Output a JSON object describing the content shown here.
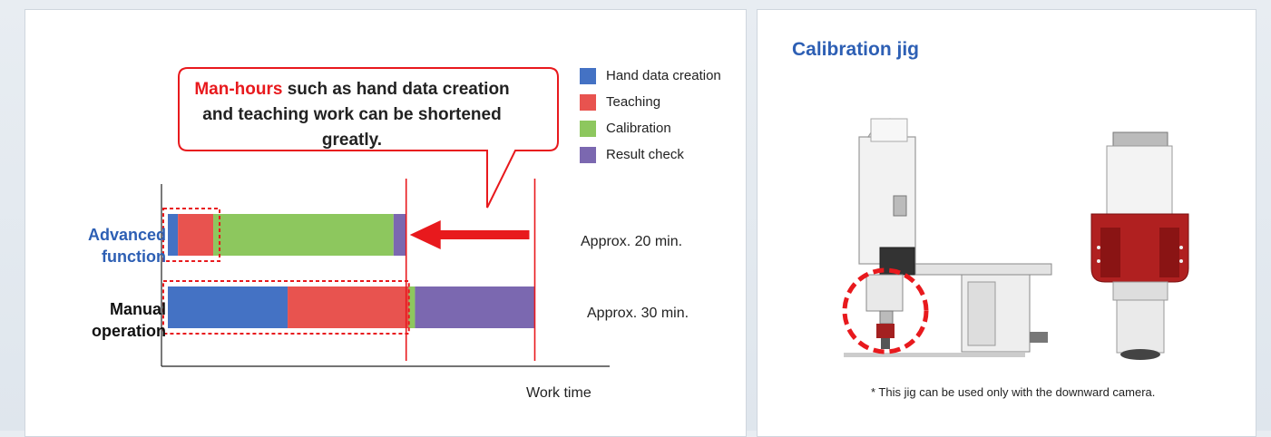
{
  "left_panel": {
    "callout": {
      "highlight": "Man-hours",
      "rest": " such as hand data creation and teaching work can be shortened greatly."
    }
  },
  "right_panel": {
    "title": "Calibration jig",
    "footnote": "* This jig can be used only with the downward camera."
  },
  "chart_data": {
    "type": "bar",
    "orientation": "horizontal",
    "stacked": true,
    "categories": [
      "Advanced function",
      "Manual operation"
    ],
    "series": [
      {
        "name": "Hand data creation",
        "color": "#4472c4",
        "values": [
          0.8,
          9.5
        ]
      },
      {
        "name": "Teaching",
        "color": "#e8534f",
        "values": [
          2.8,
          9.6
        ]
      },
      {
        "name": "Calibration",
        "color": "#8dc75e",
        "values": [
          14.3,
          0.5
        ]
      },
      {
        "name": "Result check",
        "color": "#7b68b0",
        "values": [
          1.0,
          9.5
        ]
      }
    ],
    "annotations": [
      "Approx. 20 min.",
      "Approx. 30 min."
    ],
    "xlabel": "Work time",
    "xlim": [
      0,
      30
    ],
    "legend": "top-right"
  }
}
